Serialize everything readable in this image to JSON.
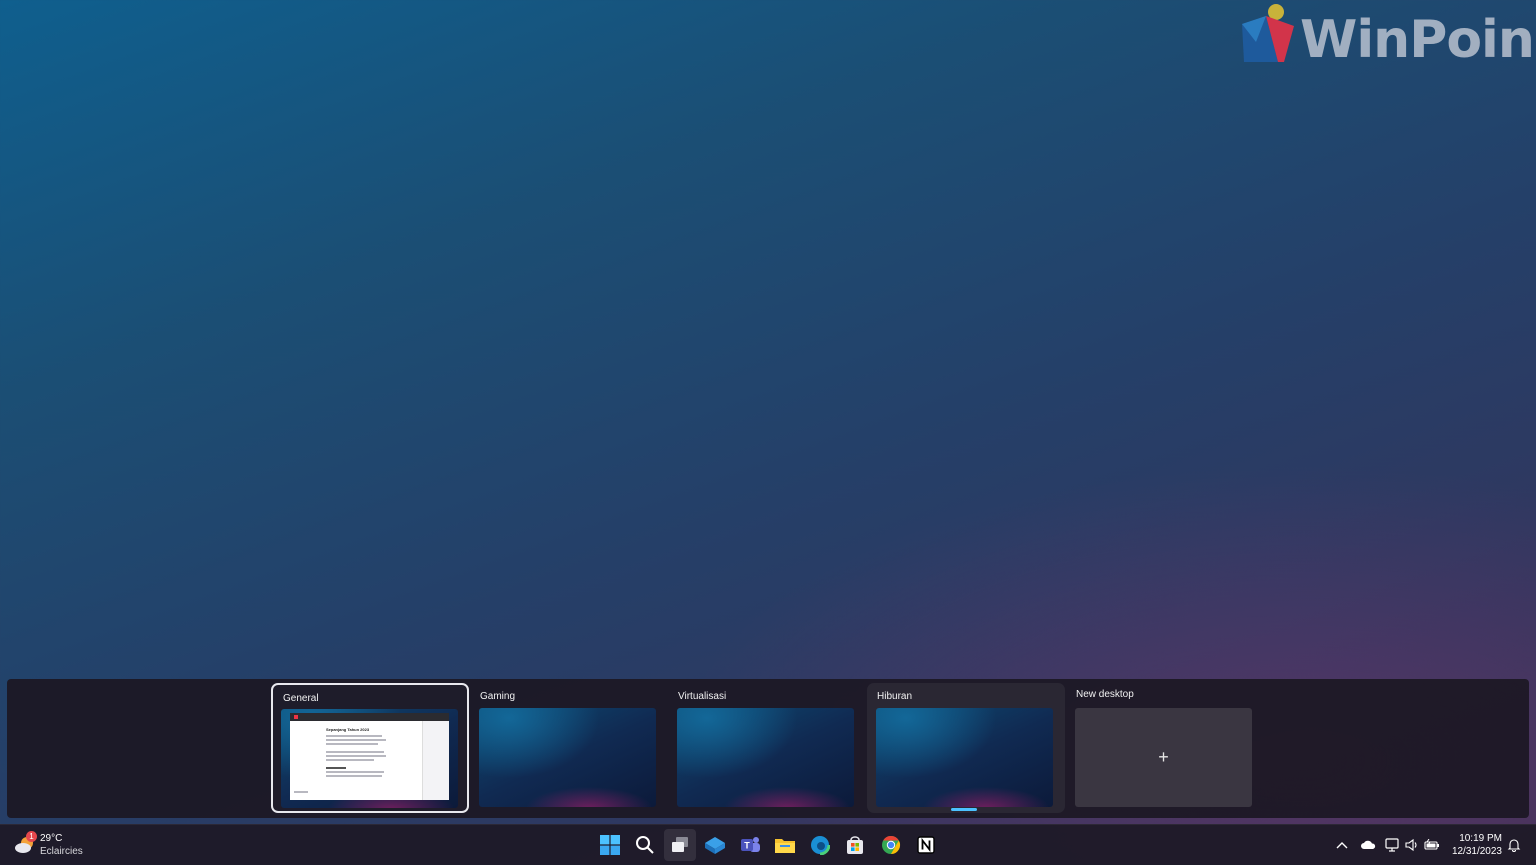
{
  "watermark": {
    "text": "WinPoin"
  },
  "task_view": {
    "desktops": [
      {
        "title": "General",
        "selected": true
      },
      {
        "title": "Gaming"
      },
      {
        "title": "Virtualisasi"
      },
      {
        "title": "Hiburan",
        "current": true
      }
    ],
    "new_desktop": {
      "title": "New desktop",
      "plus": "+"
    },
    "general_preview": {
      "heading": "Sepanjang Tahun 2023"
    }
  },
  "taskbar": {
    "weather": {
      "temp": "29°C",
      "condition": "Eclaircies",
      "badge": "1"
    },
    "apps": [
      "windows-start",
      "search",
      "task-view",
      "widgets",
      "teams",
      "file-explorer",
      "edge",
      "microsoft-store",
      "chrome",
      "notion"
    ],
    "tray": [
      "chevron-up",
      "onedrive-cloud",
      "network",
      "volume",
      "battery",
      "notifications"
    ],
    "clock": {
      "time": "10:19 PM",
      "date": "12/31/2023"
    }
  },
  "colors": {
    "accent": "#4cc2ff",
    "badge": "#e5484d"
  }
}
